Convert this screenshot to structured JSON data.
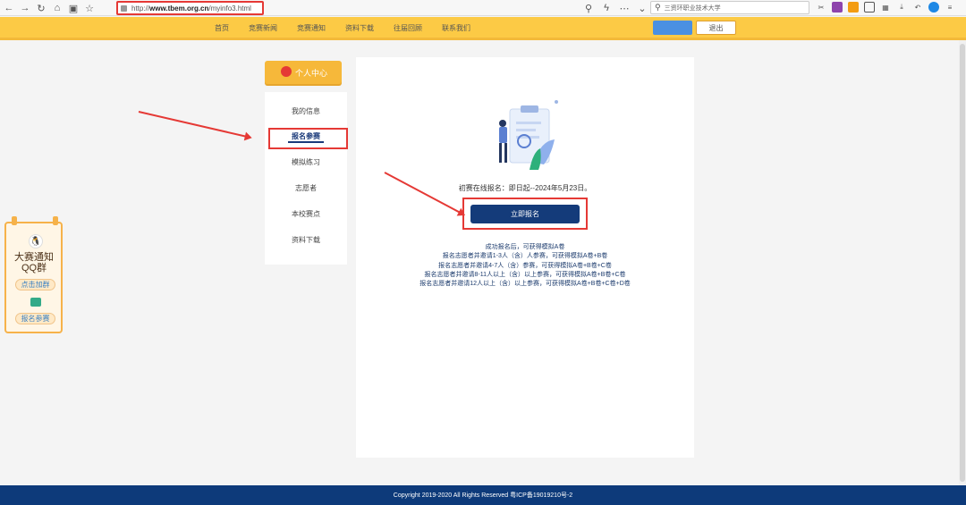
{
  "browser": {
    "url_prefix": "http://",
    "url_domain": "www.tbem.org.cn",
    "url_path": "/myinfo3.html",
    "search_text": "三资环职业技术大学"
  },
  "site_nav": {
    "items": [
      "首页",
      "竞赛新闻",
      "竞赛通知",
      "资料下载",
      "往届回顾",
      "联系我们"
    ],
    "logout_label": "退出"
  },
  "floater": {
    "title_line1": "大赛通知",
    "title_line2": "QQ群",
    "join_label": "点击加群",
    "register_label": "报名参赛"
  },
  "left_menu": {
    "header": "个人中心",
    "items": [
      "我的信息",
      "报名参赛",
      "模拟练习",
      "志愿者",
      "本校赛点",
      "资料下载"
    ]
  },
  "main": {
    "date_text": "初赛在线报名：即日起--2024年5月23日。",
    "cta_label": "立即报名",
    "info_lines": [
      "成功报名后，可获得模拟A卷",
      "报名志愿者并邀请1-3人（含）人参赛，可获得模拟A卷+B卷",
      "报名志愿者并邀请4-7人（含）参赛，可获得模拟A卷+B卷+C卷",
      "报名志愿者并邀请8-11人以上（含）以上参赛，可获得模拟A卷+B卷+C卷",
      "报名志愿者并邀请12人以上（含）以上参赛，可获得模拟A卷+B卷+C卷+D卷"
    ]
  },
  "footer": {
    "text": "Copyright 2019-2020 All Rights Reserved 粤ICP备19019210号-2"
  },
  "colors": {
    "nav_bg": "#fcca45",
    "accent": "#f6b83a",
    "cta": "#143b7a",
    "footer": "#0d3a7a",
    "highlight": "#e53935"
  }
}
